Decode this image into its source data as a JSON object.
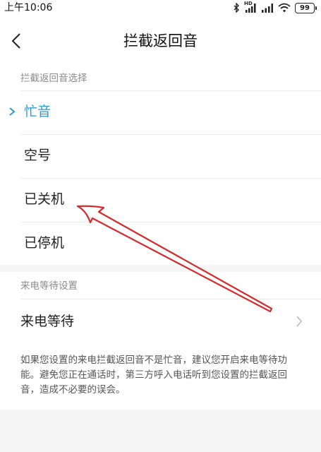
{
  "status_bar": {
    "time": "上午10:06",
    "battery": "99",
    "network_badge": "HD"
  },
  "header": {
    "title": "拦截返回音"
  },
  "sections": {
    "return_tone": {
      "header": "拦截返回音选择",
      "options": [
        {
          "label": "忙音",
          "selected": true
        },
        {
          "label": "空号",
          "selected": false
        },
        {
          "label": "已关机",
          "selected": false
        },
        {
          "label": "已停机",
          "selected": false
        }
      ]
    },
    "call_waiting": {
      "header": "来电等待设置",
      "row_label": "来电等待",
      "description": "如果您设置的来电拦截返回音不是忙音，建议您开启来电等待功能。避免您正在通话时，第三方呼入电话听到您设置的拦截返回音，造成不必要的误会。"
    }
  },
  "colors": {
    "accent": "#2a9ad8",
    "annotation": "#d42b2b",
    "background": "#f5f5f5"
  }
}
